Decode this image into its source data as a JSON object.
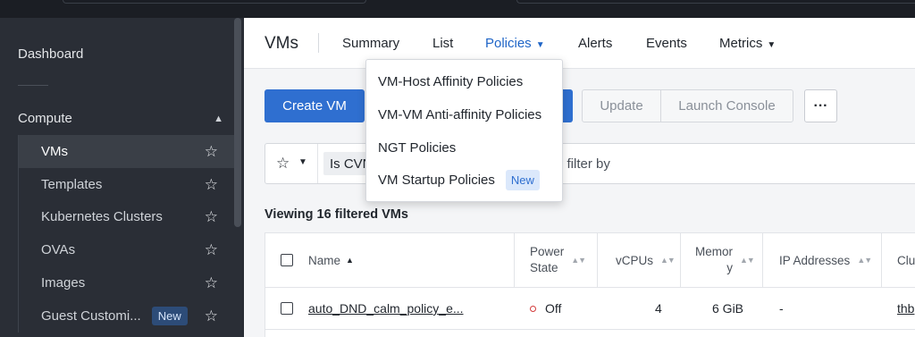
{
  "sidebar": {
    "dashboard": "Dashboard",
    "section": "Compute",
    "items": [
      {
        "label": "VMs",
        "active": true
      },
      {
        "label": "Templates"
      },
      {
        "label": "Kubernetes Clusters"
      },
      {
        "label": "OVAs"
      },
      {
        "label": "Images"
      },
      {
        "label": "Guest Customi...",
        "badge": "New"
      }
    ]
  },
  "header": {
    "title": "VMs",
    "tabs": [
      "Summary",
      "List",
      "Policies",
      "Alerts",
      "Events",
      "Metrics"
    ],
    "active_tab": "Policies"
  },
  "toolbar": {
    "create_vm": "Create VM",
    "update": "Update",
    "launch_console": "Launch Console",
    "more": "···"
  },
  "filter": {
    "chip": "Is CVN",
    "placeholder": "e filter by"
  },
  "viewing": "Viewing 16 filtered VMs",
  "table": {
    "headers": [
      "Name",
      "Power State",
      "vCPUs",
      "Memory",
      "IP Addresses",
      "Clu"
    ],
    "header_memory_line1": "Memor",
    "header_memory_line2": "y",
    "header_power_line1": "Power",
    "header_power_line2": "State",
    "rows": [
      {
        "name": "auto_DND_calm_policy_e...",
        "power": "Off",
        "vcpus": "4",
        "memory": "6 GiB",
        "ip": "-",
        "cluster": "thb"
      }
    ]
  },
  "policies_menu": {
    "items": [
      "VM-Host Affinity Policies",
      "VM-VM Anti-affinity Policies",
      "NGT Policies",
      "VM Startup Policies"
    ],
    "new_badge": "New"
  },
  "colors": {
    "primary": "#2f6fd0",
    "sidebar_bg": "#2a2e36",
    "active_tab": "#1f65c7",
    "off_status": "#d33b3b"
  }
}
